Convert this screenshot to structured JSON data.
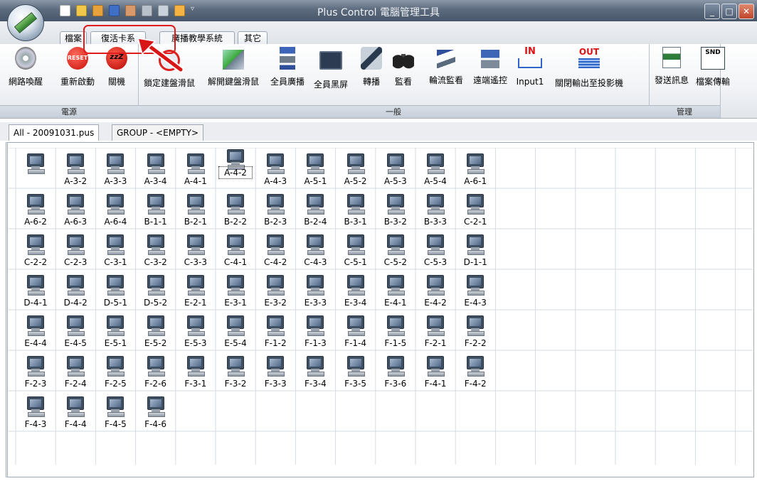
{
  "window": {
    "title": "Plus Control 電腦管理工具"
  },
  "ribbon_tabs": [
    "檔案",
    "復活卡系",
    "廣播教學系統",
    "其它"
  ],
  "groups": {
    "power": {
      "label": "電源",
      "buttons": [
        "網路喚醒",
        "重新啟動",
        "關機"
      ]
    },
    "general": {
      "label": "一般",
      "buttons": [
        "鎖定建盤滑鼠",
        "解開鍵盤滑鼠",
        "全員廣播",
        "全員黑屏",
        "轉播",
        "監看",
        "輪流監看",
        "遠端遙控",
        "Input1",
        "關閉輸出至投影機"
      ]
    },
    "manage": {
      "label": "管理",
      "buttons": [
        "發送訊息",
        "檔案傳輸"
      ]
    }
  },
  "icon_text": {
    "reset": "RESET",
    "sleep": "zzZ",
    "in": "IN",
    "out": "OUT",
    "snd": "SND"
  },
  "doc_tabs": [
    "All - 20091031.pus",
    "GROUP - <EMPTY>"
  ],
  "computers": [
    "",
    "A-3-2",
    "A-3-3",
    "A-3-4",
    "A-4-1",
    "A-4-2",
    "A-4-3",
    "A-5-1",
    "A-5-2",
    "A-5-3",
    "A-5-4",
    "A-6-1",
    "A-6-2",
    "A-6-3",
    "A-6-4",
    "B-1-1",
    "B-2-1",
    "B-2-2",
    "B-2-3",
    "B-2-4",
    "B-3-1",
    "B-3-2",
    "B-3-3",
    "C-2-1",
    "C-2-2",
    "C-2-3",
    "C-3-1",
    "C-3-2",
    "C-3-3",
    "C-4-1",
    "C-4-2",
    "C-4-3",
    "C-5-1",
    "C-5-2",
    "C-5-3",
    "D-1-1",
    "D-4-1",
    "D-4-2",
    "D-5-1",
    "D-5-2",
    "E-2-1",
    "E-3-1",
    "E-3-2",
    "E-3-3",
    "E-3-4",
    "E-4-1",
    "E-4-2",
    "E-4-3",
    "E-4-4",
    "E-4-5",
    "E-5-1",
    "E-5-2",
    "E-5-3",
    "E-5-4",
    "F-1-2",
    "F-1-3",
    "F-1-4",
    "F-1-5",
    "F-2-1",
    "F-2-2",
    "F-2-3",
    "F-2-4",
    "F-2-5",
    "F-2-6",
    "F-3-1",
    "F-3-2",
    "F-3-3",
    "F-3-4",
    "F-3-5",
    "F-3-6",
    "F-4-1",
    "F-4-2",
    "F-4-3",
    "F-4-4",
    "F-4-5",
    "F-4-6"
  ],
  "selected_computer": "A-4-2"
}
